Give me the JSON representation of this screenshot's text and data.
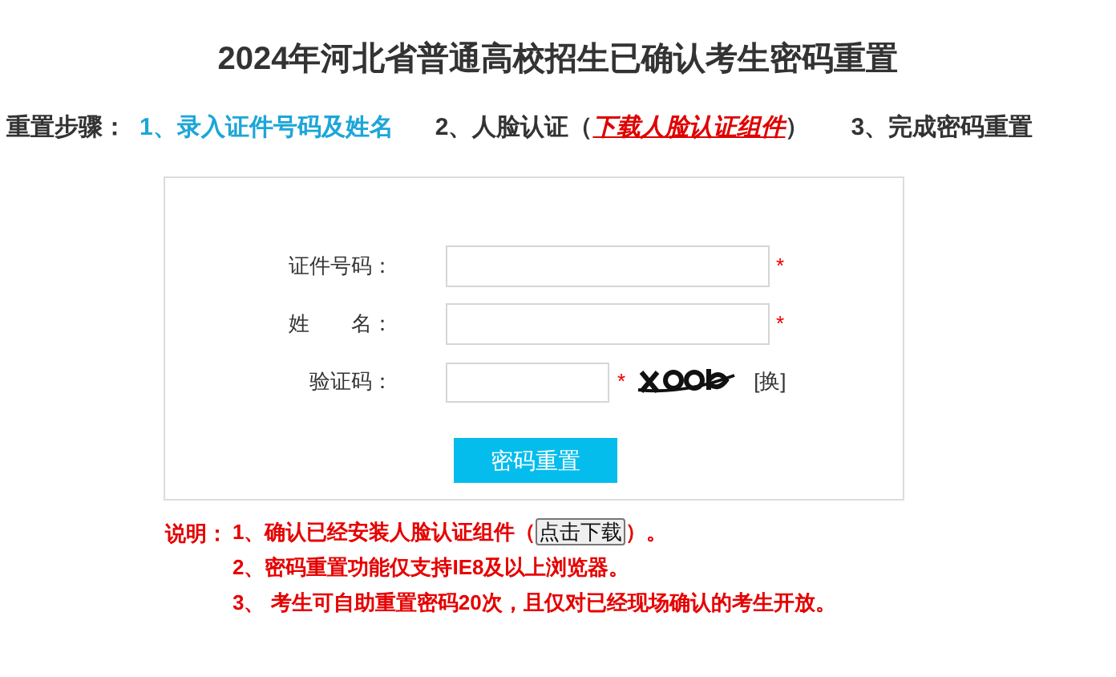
{
  "title": "2024年河北省普通高校招生已确认考生密码重置",
  "steps": {
    "label": "重置步骤：",
    "items": [
      {
        "text": "1、录入证件号码及姓名",
        "selected": true
      },
      {
        "text": "2、人脸认证（",
        "link": "下载人脸认证组件",
        "text_after": "）",
        "selected": false
      },
      {
        "text": "3、完成密码重置",
        "selected": false
      }
    ]
  },
  "form": {
    "fields": [
      {
        "kind": "text",
        "label": "证件号码：",
        "required_mark": "*"
      },
      {
        "kind": "text",
        "label": "姓　　名：",
        "required_mark": "*"
      },
      {
        "kind": "captcha",
        "label": "验证码：",
        "required_mark": "*",
        "refresh": "[换]"
      }
    ],
    "submit": "密码重置"
  },
  "notes": {
    "label": "说明：",
    "items": [
      {
        "text": "1、确认已经安装人脸认证组件（",
        "button": "点击下载",
        "text_after": "）。"
      },
      {
        "text": "2、密码重置功能仅支持IE8及以上浏览器。"
      },
      {
        "text": "3、 考生可自助重置密码20次，且仅对已经现场确认的考生开放。"
      }
    ]
  }
}
